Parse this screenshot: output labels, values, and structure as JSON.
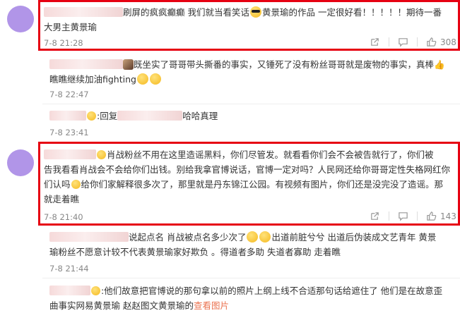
{
  "comments": [
    {
      "name_hidden": true,
      "text_line1": "刷屏的疯疯癫癫 我们就当看笑话",
      "text_line1b": "黄景瑜的作品 一定很好看！！！！！期待一番",
      "text_line2": "大男主黄景瑜",
      "time": "7-8 21:28",
      "likes": "308"
    },
    {
      "text_line1": "既坐实了哥哥带头撕番的事实，又锤死了没有粉丝哥哥就是废物的事实，真棒",
      "text_line2": "瞧瞧继续加油fighting",
      "time": "7-8 22:47"
    },
    {
      "text_prefix": ":回复",
      "text_suffix": "哈哈真理",
      "time": "7-8 23:41"
    },
    {
      "line1": "肖战粉丝不用在这里造谣黑料，你们尽管发。就看看你们会不会被告就行了，你们被",
      "line2": "告我看看肖战会不会给你们出钱。别给我拿官博说话，官博一定对吗？人民网还给你哥哥定性失格网红你",
      "line3a": "们认吗",
      "line3b": "给你们家解释很多次了，那里就是丹东锦江公园。有视频有图片，你们还是没完没了造谣。那",
      "line4": "就走着瞧",
      "time": "7-8 21:40",
      "likes": "143"
    },
    {
      "line1a": "说起点名 肖战被点名多少次了",
      "line1b": "出道前脏兮兮 出道后伪装成文艺青年 黄景",
      "line2": "瑜粉丝不愿意计较不代表黄景瑜家好欺负 。得道者多助 失道者寡助 走着瞧",
      "time": "7-8 21:44"
    },
    {
      "line1": ":他们故意把官博说的那句拿以前的照片上纲上线不合适那句话给遮住了 他们是在故意歪",
      "line2": "曲事实网易黄景瑜 赵赵图文黄景瑜的",
      "link": "查看图片"
    }
  ],
  "colors": {
    "highlight": "#e60012",
    "avatar": "#b195e8",
    "meta": "#888888",
    "link": "#eb7350"
  },
  "icons": [
    "share-icon",
    "comment-icon",
    "like-icon"
  ]
}
